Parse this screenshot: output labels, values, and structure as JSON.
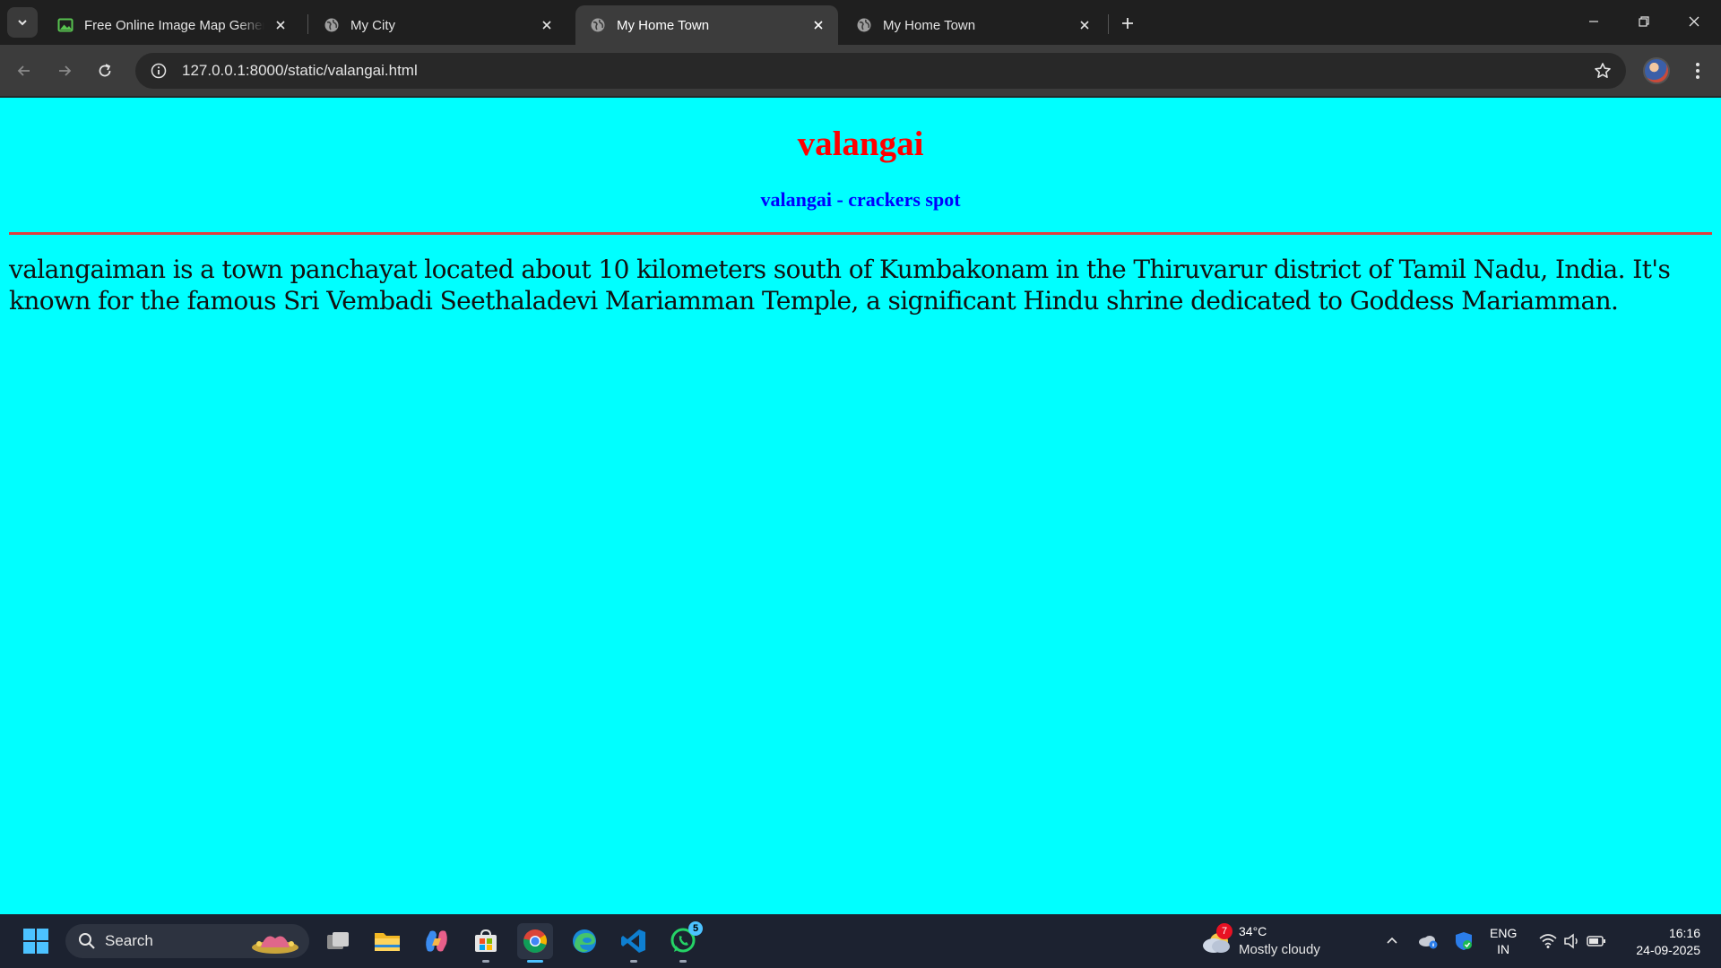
{
  "browser": {
    "tabs": [
      {
        "title": "Free Online Image Map Generator",
        "favicon": "image-icon",
        "active": false
      },
      {
        "title": "My City",
        "favicon": "globe-icon",
        "active": false
      },
      {
        "title": "My Home Town",
        "favicon": "globe-icon",
        "active": true
      },
      {
        "title": "My Home Town",
        "favicon": "globe-icon",
        "active": false
      }
    ],
    "url": "127.0.0.1:8000/static/valangai.html"
  },
  "page": {
    "background": "#00ffff",
    "title": "valangai",
    "title_color": "#ff0000",
    "subtitle": "valangai - crackers spot",
    "subtitle_color": "#0000ff",
    "rule_color": "#e03c3c",
    "body": "valangaiman is a town panchayat located about 10 kilometers south of Kumbakonam in the Thiruvarur district of Tamil Nadu, India. It's known for the famous Sri Vembadi Seethaladevi Mariamman Temple, a significant Hindu shrine dedicated to Goddess Mariamman."
  },
  "taskbar": {
    "search_label": "Search",
    "whatsapp_badge": "5",
    "weather": {
      "badge": "7",
      "temp": "34°C",
      "condition": "Mostly cloudy"
    },
    "language": {
      "line1": "ENG",
      "line2": "IN"
    },
    "clock": {
      "time": "16:16",
      "date": "24-09-2025"
    }
  }
}
